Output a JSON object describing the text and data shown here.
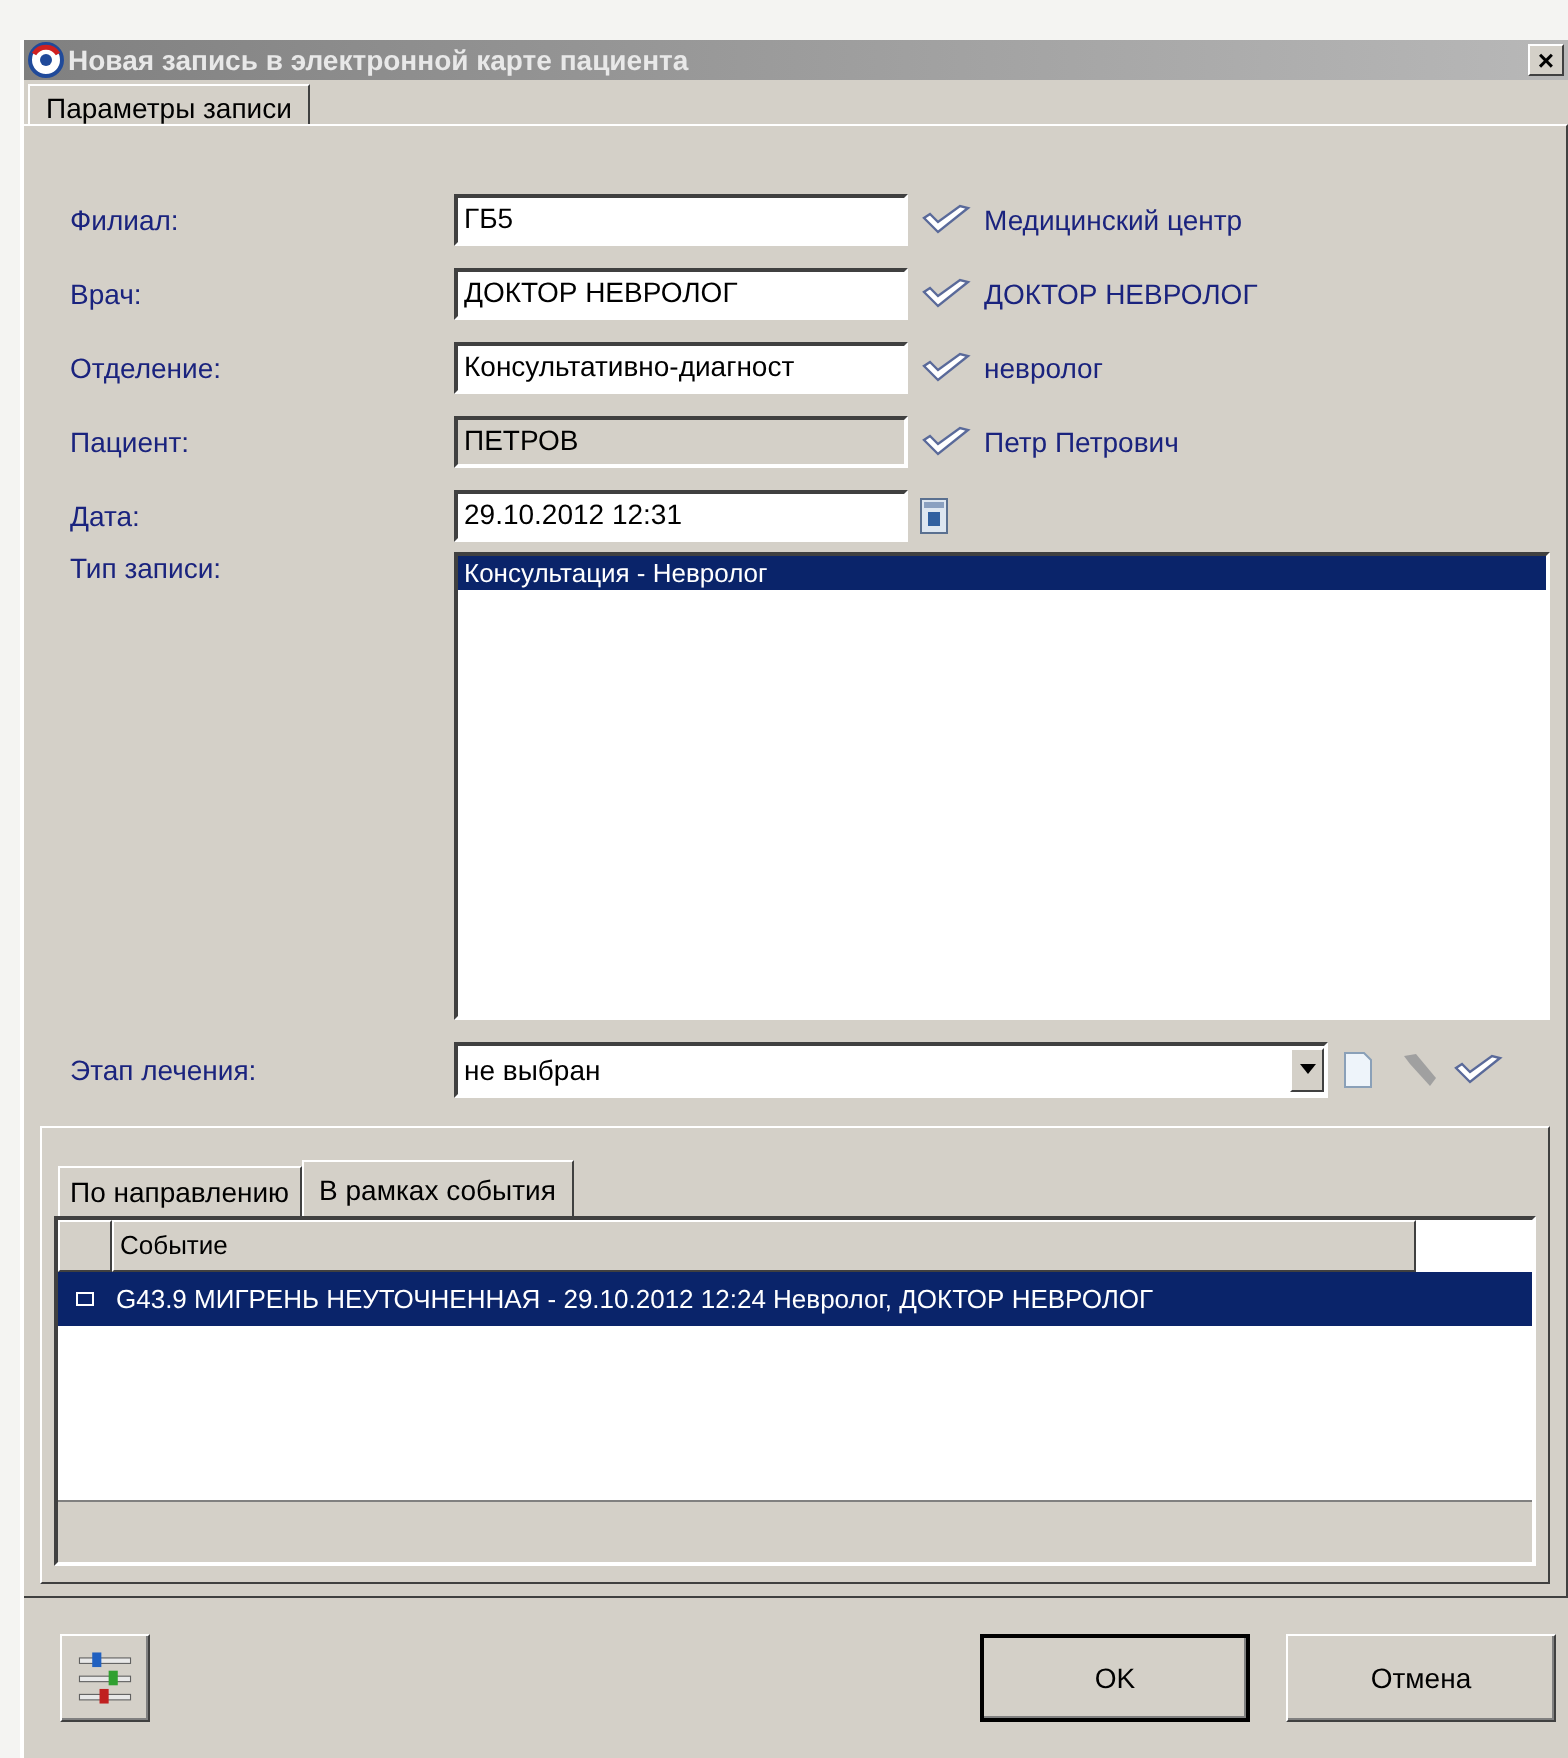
{
  "window": {
    "title": "Новая запись в электронной карте пациента",
    "close": "×"
  },
  "tabs": [
    {
      "label": "Параметры записи",
      "selected": true
    }
  ],
  "fields": [
    {
      "label": "Филиал:",
      "value": "ГБ5",
      "disabled": false,
      "link": "Медицинский центр"
    },
    {
      "label": "Врач:",
      "value": "ДОКТОР НЕВРОЛОГ",
      "disabled": false,
      "link": "ДОКТОР НЕВРОЛОГ"
    },
    {
      "label": "Отделение:",
      "value": "Консультативно-диагност",
      "disabled": false,
      "link": "невролог"
    },
    {
      "label": "Пациент:",
      "value": "ПЕТРОВ",
      "disabled": true,
      "link": "Петр Петрович"
    },
    {
      "label": "Дата:",
      "value": "29.10.2012 12:31",
      "disabled": false,
      "kind": "date"
    }
  ],
  "record_type": {
    "label": "Тип записи:",
    "items": [
      {
        "text": "Консультация - Невролог",
        "selected": true
      }
    ]
  },
  "stage": {
    "label": "Этап лечения:",
    "value": "не выбран"
  },
  "inner_tabs": [
    {
      "label": "По направлению",
      "selected": false
    },
    {
      "label": "В рамках события",
      "selected": true
    }
  ],
  "events": {
    "columns": [
      "Событие"
    ],
    "rows": [
      {
        "text": "G43.9 МИГРЕНЬ НЕУТОЧНЕННАЯ - 29.10.2012 12:24 Невролог, ДОКТОР НЕВРОЛОГ",
        "selected": true
      }
    ]
  },
  "buttons": [
    {
      "label": "OK",
      "default": true
    },
    {
      "label": "Отмена",
      "default": false
    }
  ]
}
